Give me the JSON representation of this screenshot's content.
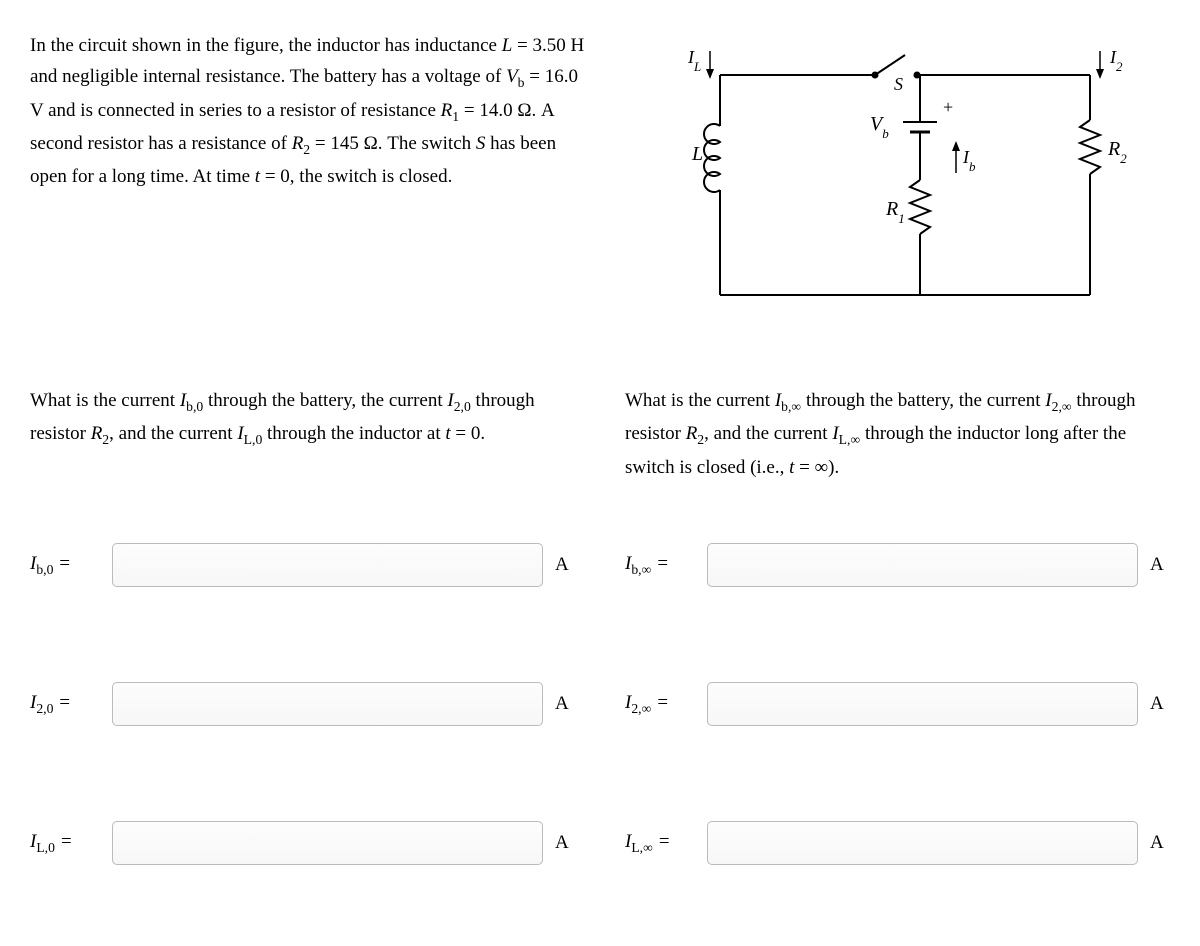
{
  "problem": {
    "text_html": "In the circuit shown in the figure, the inductor has inductance <span class='italic'>L</span> = 3.50 H and negligible internal resistance. The battery has a voltage of <span class='italic'>V</span><sub>b</sub> = 16.0 V and is connected in series to a resistor of resistance <span class='italic'>R</span><sub>1</sub> = 14.0 Ω. A second resistor has a resistance of <span class='italic'>R</span><sub>2</sub> = 145 Ω. The switch <span class='italic'>S</span> has been open for a long time. At time <span class='italic'>t</span> = 0, the switch is closed."
  },
  "circuit": {
    "IL": "I",
    "IL_sub": "L",
    "I2": "I",
    "I2_sub": "2",
    "S": "S",
    "Vb": "V",
    "Vb_sub": "b",
    "Ib": "I",
    "Ib_sub": "b",
    "L": "L",
    "R1": "R",
    "R1_sub": "1",
    "R2": "R",
    "R2_sub": "2",
    "plus": "+"
  },
  "questions": {
    "q1_html": "What is the current <span class='italic'>I</span><sub>b,0</sub> through the battery, the current <span class='italic'>I</span><sub>2,0</sub> through resistor <span class='italic'>R</span><sub>2</sub>, and the current <span class='italic'>I</span><sub>L,0</sub> through the inductor at <span class='italic'>t</span> = 0.",
    "q2_html": "What is the current <span class='italic'>I</span><sub>b,∞</sub> through the battery, the current <span class='italic'>I</span><sub>2,∞</sub> through resistor <span class='italic'>R</span><sub>2</sub>, and the current <span class='italic'>I</span><sub>L,∞</sub> through the inductor long after the switch is closed (i.e., <span class='italic'>t</span> = ∞)."
  },
  "answers": {
    "left": [
      {
        "label_html": "<span class='italic'>I</span><sub>b,0</sub> =",
        "unit": "A"
      },
      {
        "label_html": "<span class='italic'>I</span><sub>2,0</sub> =",
        "unit": "A"
      },
      {
        "label_html": "<span class='italic'>I</span><sub>L,0</sub> =",
        "unit": "A"
      }
    ],
    "right": [
      {
        "label_html": "<span class='italic'>I</span><sub>b,∞</sub> =",
        "unit": "A"
      },
      {
        "label_html": "<span class='italic'>I</span><sub>2,∞</sub> =",
        "unit": "A"
      },
      {
        "label_html": "<span class='italic'>I</span><sub>L,∞</sub> =",
        "unit": "A"
      }
    ]
  }
}
